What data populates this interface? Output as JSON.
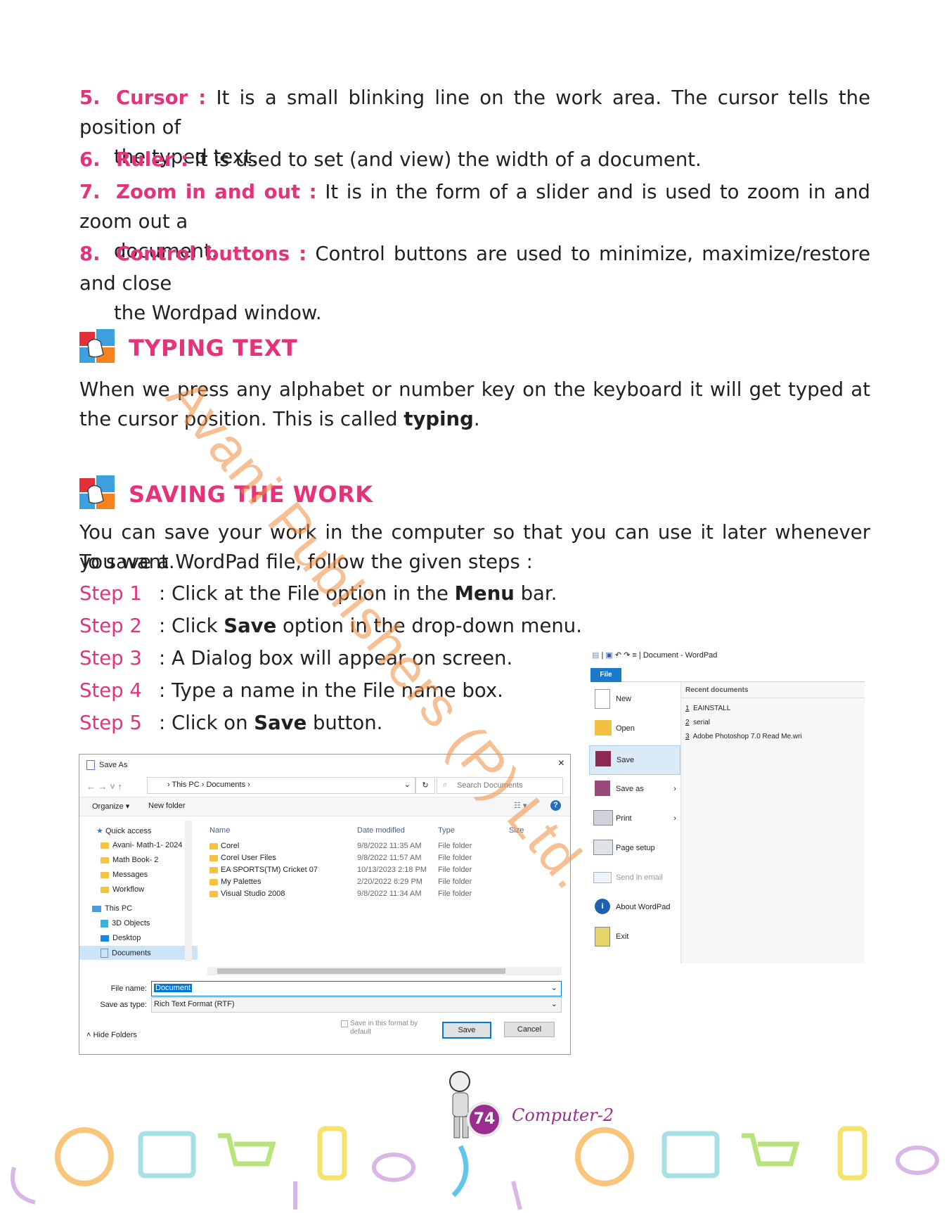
{
  "items": [
    {
      "num": "5.",
      "term": "Cursor :",
      "text": " It is a small blinking line on the work area. The cursor tells the position of",
      "cont": "the typed text."
    },
    {
      "num": "6.",
      "term": "Ruler :",
      "text": " It is used to set (and view) the width of a document.",
      "cont": ""
    },
    {
      "num": "7.",
      "term": "Zoom in and out :",
      "text": " It is in the form of a slider and is used to zoom in and zoom out a",
      "cont": "document."
    },
    {
      "num": "8.",
      "term": "Control buttons :",
      "text": " Control buttons are used to minimize, maximize/restore and close",
      "cont": "the Wordpad window."
    }
  ],
  "typing": {
    "heading": "TYPING TEXT",
    "para_a": "When we press any alphabet or number key on the keyboard it will get typed at the cursor position. This is called ",
    "para_bold": "typing",
    "para_end": "."
  },
  "saving": {
    "heading": "SAVING THE WORK",
    "para1": "You can save your work in the computer so that you can use it later whenever you want.",
    "para2": "To save a WordPad file, follow the given steps :",
    "steps": [
      {
        "label": "Step 1",
        "pre": ": Click at the File option in the ",
        "bold": "Menu",
        "post": " bar."
      },
      {
        "label": "Step 2",
        "pre": ": Click ",
        "bold": "Save",
        "post": " option in the drop-down menu."
      },
      {
        "label": "Step 3",
        "pre": ": A Dialog box will appear on screen.",
        "bold": "",
        "post": ""
      },
      {
        "label": "Step 4",
        "pre": ": Type a name in the File name box.",
        "bold": "",
        "post": ""
      },
      {
        "label": "Step 5",
        "pre": ": Click on  ",
        "bold": "Save",
        "post": " button."
      }
    ]
  },
  "watermark": "Avani Publishers (P) Ltd.",
  "save_dialog": {
    "title": "Save As",
    "breadcrumb": [
      "This PC",
      "Documents"
    ],
    "search_placeholder": "Search Documents",
    "organize": "Organize ▾",
    "new_folder": "New folder",
    "columns": [
      "Name",
      "Date modified",
      "Type",
      "Size"
    ],
    "nav": [
      {
        "label": "Quick access",
        "kind": "star"
      },
      {
        "label": "Avani- Math-1- 2024",
        "kind": "folder"
      },
      {
        "label": "Math Book- 2",
        "kind": "folder"
      },
      {
        "label": "Messages",
        "kind": "folder"
      },
      {
        "label": "Workflow",
        "kind": "folder"
      },
      {
        "label": "This PC",
        "kind": "pc"
      },
      {
        "label": "3D Objects",
        "kind": "cube"
      },
      {
        "label": "Desktop",
        "kind": "desk"
      },
      {
        "label": "Documents",
        "kind": "doc"
      }
    ],
    "files": [
      {
        "name": "Corel",
        "date": "9/8/2022 11:35 AM",
        "type": "File folder"
      },
      {
        "name": "Corel User Files",
        "date": "9/8/2022 11:57 AM",
        "type": "File folder"
      },
      {
        "name": "EA SPORTS(TM) Cricket 07",
        "date": "10/13/2023 2:18 PM",
        "type": "File folder"
      },
      {
        "name": "My Palettes",
        "date": "2/20/2022 6:29 PM",
        "type": "File folder"
      },
      {
        "name": "Visual Studio 2008",
        "date": "9/8/2022 11:34 AM",
        "type": "File folder"
      }
    ],
    "file_name_label": "File name:",
    "file_name_value": "Document",
    "save_type_label": "Save as type:",
    "save_type_value": "Rich Text Format (RTF)",
    "save_format_checkbox": "Save in this format by default",
    "save_button": "Save",
    "cancel_button": "Cancel",
    "hide_folders": "Hide Folders"
  },
  "wordpad_menu": {
    "title": "Document - WordPad",
    "file_tab": "File",
    "items": [
      "New",
      "Open",
      "Save",
      "Save as",
      "Print",
      "Page setup",
      "Send in email",
      "About WordPad",
      "Exit"
    ],
    "recent_heading": "Recent documents",
    "recent": [
      {
        "n": "1",
        "name": "EAINSTALL"
      },
      {
        "n": "2",
        "name": "serial"
      },
      {
        "n": "3",
        "name": "Adobe Photoshop 7.0 Read Me.wri"
      }
    ]
  },
  "footer": {
    "page_number": "74",
    "book": "Computer-2"
  },
  "colors": {
    "accent": "#e6317b",
    "watermark": "#f08c3c",
    "selection": "#0078d7"
  }
}
